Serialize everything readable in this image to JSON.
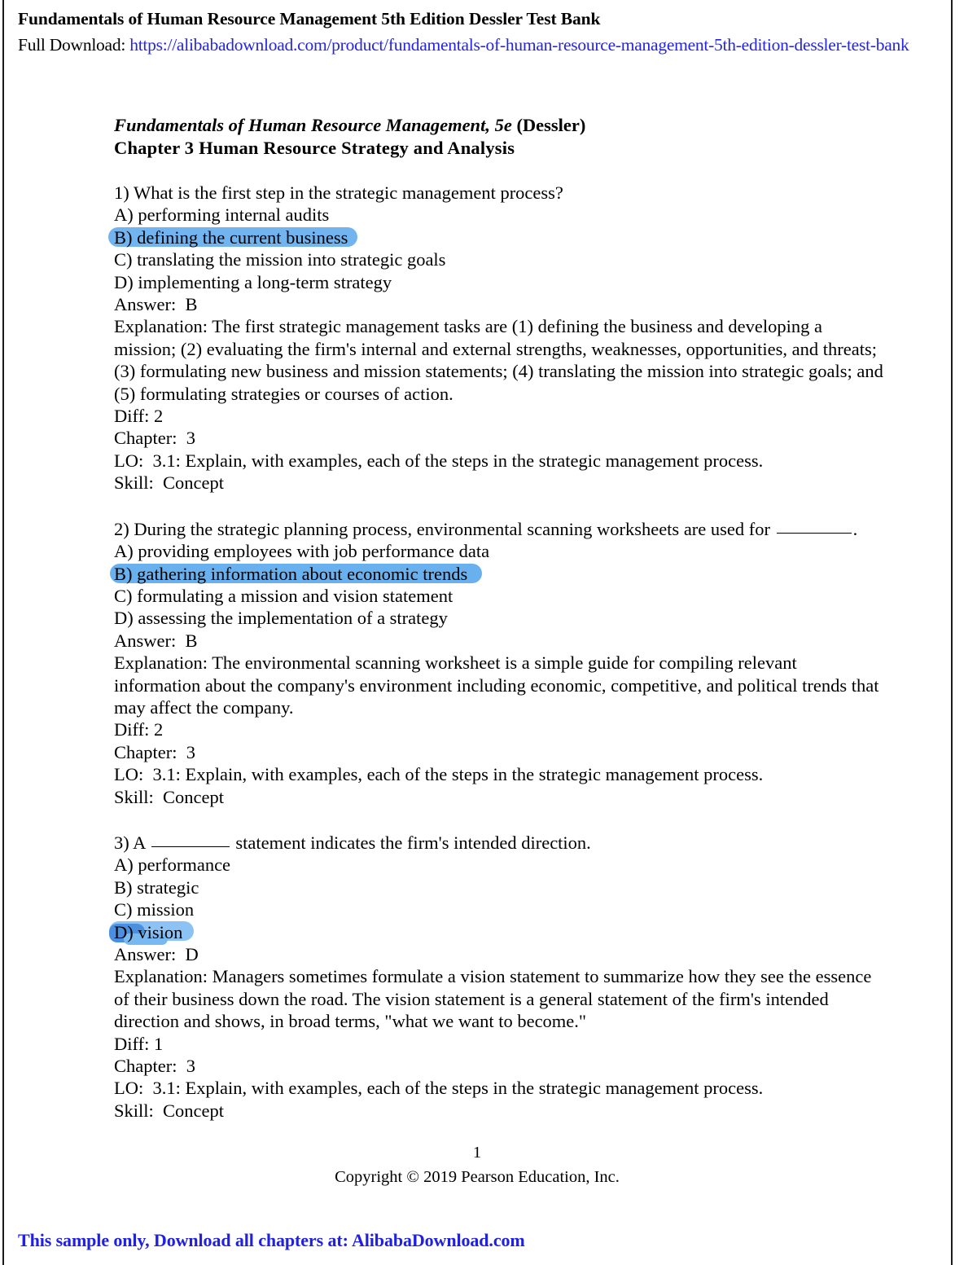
{
  "banner": {
    "title": "Fundamentals of Human Resource Management 5th Edition Dessler Test Bank",
    "download_label": "Full Download: ",
    "download_url": "https://alibabadownload.com/product/fundamentals-of-human-resource-management-5th-edition-dessler-test-bank"
  },
  "doc": {
    "title_italic": "Fundamentals of Human Resource Management, 5e ",
    "title_roman": "(Dessler)",
    "chapter_line": "Chapter 3   Human Resource Strategy and Analysis"
  },
  "questions": [
    {
      "stem": "1) What is the first step in the strategic management process?",
      "options": [
        {
          "label": "A) performing internal audits",
          "highlighted": false
        },
        {
          "label": "B) defining the current business",
          "highlighted": true
        },
        {
          "label": "C) translating the mission into strategic goals",
          "highlighted": false
        },
        {
          "label": "D) implementing a long-term strategy",
          "highlighted": false
        }
      ],
      "answer": "Answer:  B",
      "explanation": "Explanation:  The first strategic management tasks are (1) defining the business and developing a mission; (2) evaluating the firm's internal and external strengths, weaknesses, opportunities, and threats; (3) formulating new business and mission statements; (4) translating the mission into strategic goals; and (5) formulating strategies or courses of action.",
      "diff": "Diff: 2",
      "chapter": "Chapter:  3",
      "lo": "LO:  3.1: Explain, with examples, each of the steps in the strategic management process.",
      "skill": "Skill:  Concept"
    },
    {
      "stem_part1": "2) During the strategic planning process, environmental scanning worksheets are used for",
      "stem_part2": ".",
      "options": [
        {
          "label": "A) providing employees with job performance data",
          "highlighted": false
        },
        {
          "label": "B) gathering information about economic trends",
          "highlighted": true
        },
        {
          "label": "C) formulating a mission and vision statement",
          "highlighted": false
        },
        {
          "label": "D) assessing the implementation of a strategy",
          "highlighted": false
        }
      ],
      "answer": "Answer:  B",
      "explanation": "Explanation:  The environmental scanning worksheet is a simple guide for compiling relevant information about the company's environment including economic, competitive, and political trends that may affect the company.",
      "diff": "Diff: 2",
      "chapter": "Chapter:  3",
      "lo": "LO:  3.1: Explain, with examples, each of the steps in the strategic management process.",
      "skill": "Skill:  Concept"
    },
    {
      "stem_part1": "3) A ",
      "stem_part2": " statement indicates the firm's intended direction.",
      "options": [
        {
          "label": "A) performance",
          "highlighted": false
        },
        {
          "label": "B) strategic",
          "highlighted": false
        },
        {
          "label": "C) mission",
          "highlighted": false
        },
        {
          "label": "D) vision",
          "highlighted": true
        }
      ],
      "answer": "Answer:  D",
      "explanation": "Explanation:  Managers sometimes formulate a vision statement to summarize how they see the essence of their business down the road. The vision statement is a general statement of the firm's intended direction and shows, in broad terms, \"what we want to become.\"",
      "diff": "Diff: 1",
      "chapter": "Chapter:  3",
      "lo": "LO:  3.1: Explain, with examples, each of the steps in the strategic management process.",
      "skill": "Skill:  Concept"
    }
  ],
  "footer": {
    "page_number": "1",
    "copyright": "Copyright © 2019 Pearson Education, Inc."
  },
  "promo": "This sample only, Download all chapters at: AlibabaDownload.com",
  "colors": {
    "link_blue": "#2424e8",
    "promo_blue": "#2020e0",
    "highlight_blue": "#71b4f0",
    "highlight_blue_dark": "#4b8fe0"
  }
}
